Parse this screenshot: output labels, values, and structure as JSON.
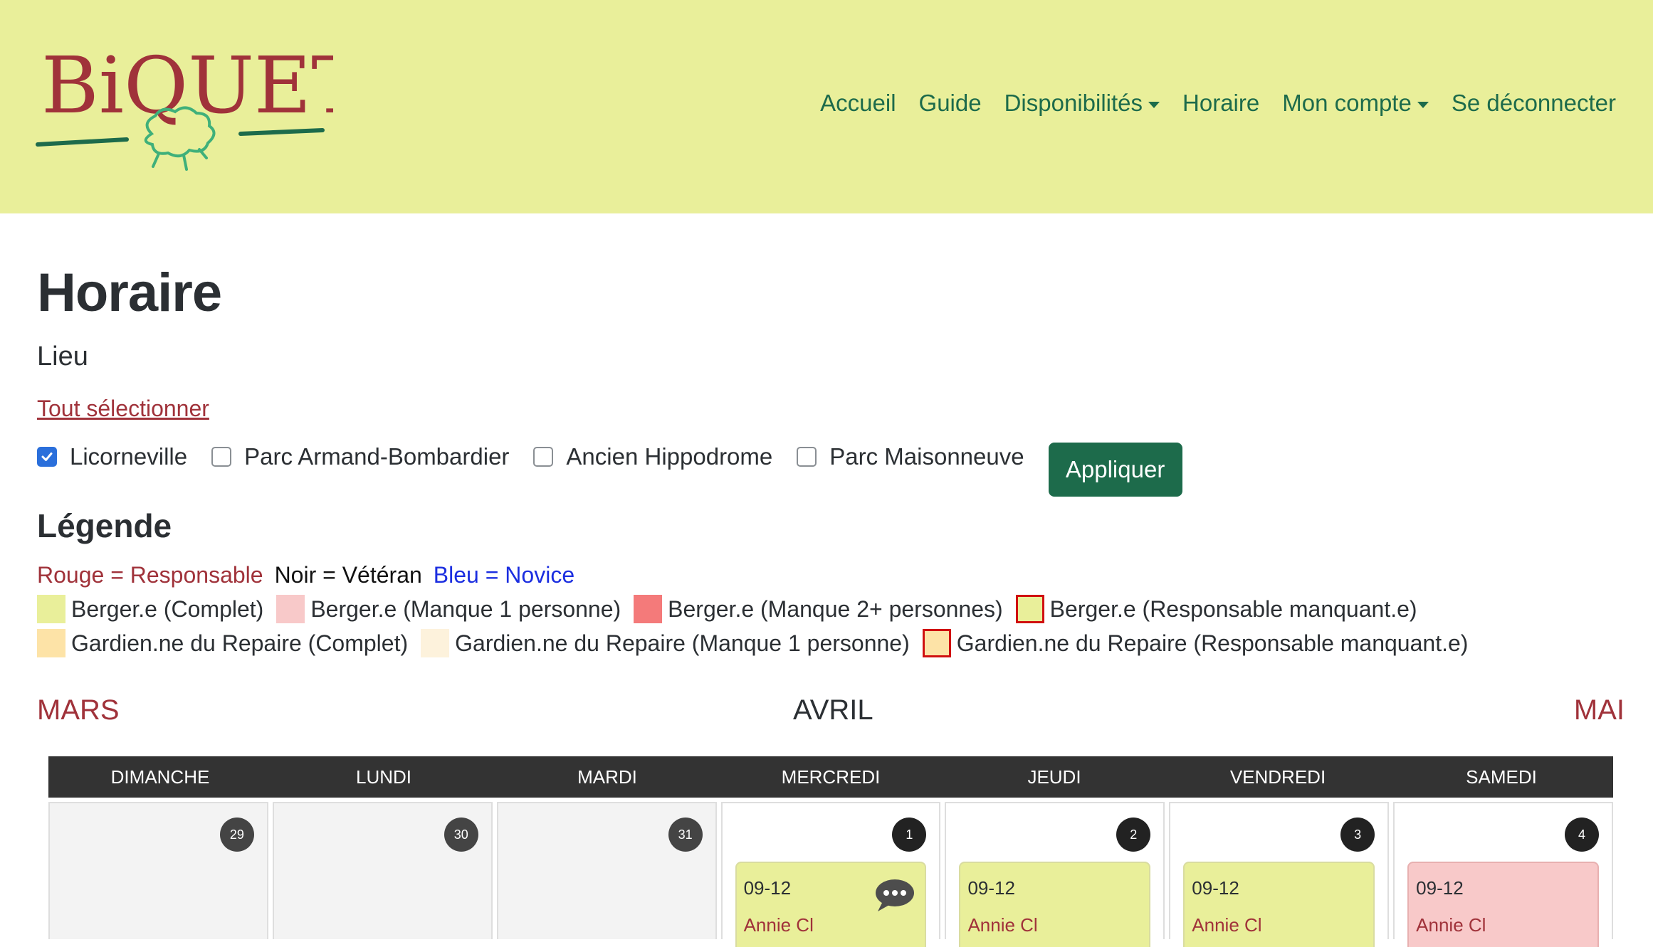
{
  "header": {
    "logo_text": "BiQUETTE",
    "nav": [
      {
        "label": "Accueil",
        "dropdown": false
      },
      {
        "label": "Guide",
        "dropdown": false
      },
      {
        "label": "Disponibilités",
        "dropdown": true
      },
      {
        "label": "Horaire",
        "dropdown": false
      },
      {
        "label": "Mon compte",
        "dropdown": true
      },
      {
        "label": "Se déconnecter",
        "dropdown": false
      }
    ]
  },
  "page": {
    "title": "Horaire",
    "lieu_label": "Lieu",
    "select_all": "Tout sélectionner",
    "locations": [
      {
        "label": "Licorneville",
        "checked": true
      },
      {
        "label": "Parc Armand-Bombardier",
        "checked": false
      },
      {
        "label": "Ancien Hippodrome",
        "checked": false
      },
      {
        "label": "Parc Maisonneuve",
        "checked": false
      }
    ],
    "apply_label": "Appliquer"
  },
  "legend": {
    "title": "Légende",
    "roles": {
      "red": "Rouge = Responsable",
      "black": "Noir = Vétéran",
      "blue": "Bleu = Novice"
    },
    "row1": [
      {
        "label": "Berger.e (Complet)",
        "color": "#e9ef9a",
        "border": "none"
      },
      {
        "label": "Berger.e (Manque 1 personne)",
        "color": "#f8c9c9",
        "border": "none"
      },
      {
        "label": "Berger.e (Manque 2+ personnes)",
        "color": "#f47a7a",
        "border": "none"
      },
      {
        "label": "Berger.e (Responsable manquant.e)",
        "color": "#e9ef9a",
        "border": "#d01010"
      }
    ],
    "row2": [
      {
        "label": "Gardien.ne du Repaire (Complet)",
        "color": "#fde3a7",
        "border": "none"
      },
      {
        "label": "Gardien.ne du Repaire (Manque 1 personne)",
        "color": "#fdf2dc",
        "border": "none"
      },
      {
        "label": "Gardien.ne du Repaire (Responsable manquant.e)",
        "color": "#fde3a7",
        "border": "#d01010"
      }
    ]
  },
  "calendar": {
    "prev_month": "MARS",
    "current_month": "AVRIL",
    "next_month": "MAI",
    "weekdays": [
      "DIMANCHE",
      "LUNDI",
      "MARDI",
      "MERCREDI",
      "JEUDI",
      "VENDREDI",
      "SAMEDI"
    ],
    "days": [
      {
        "num": "29",
        "other": true
      },
      {
        "num": "30",
        "other": true
      },
      {
        "num": "31",
        "other": true
      },
      {
        "num": "1",
        "other": false,
        "shift": {
          "time": "09-12",
          "person": "Annie Cl",
          "status": "complete",
          "comment": true
        }
      },
      {
        "num": "2",
        "other": false,
        "shift": {
          "time": "09-12",
          "person": "Annie Cl",
          "status": "complete",
          "comment": false
        }
      },
      {
        "num": "3",
        "other": false,
        "shift": {
          "time": "09-12",
          "person": "Annie Cl",
          "status": "complete",
          "comment": false
        }
      },
      {
        "num": "4",
        "other": false,
        "shift": {
          "time": "09-12",
          "person": "Annie Cl",
          "status": "missing1",
          "comment": false
        }
      }
    ]
  }
}
